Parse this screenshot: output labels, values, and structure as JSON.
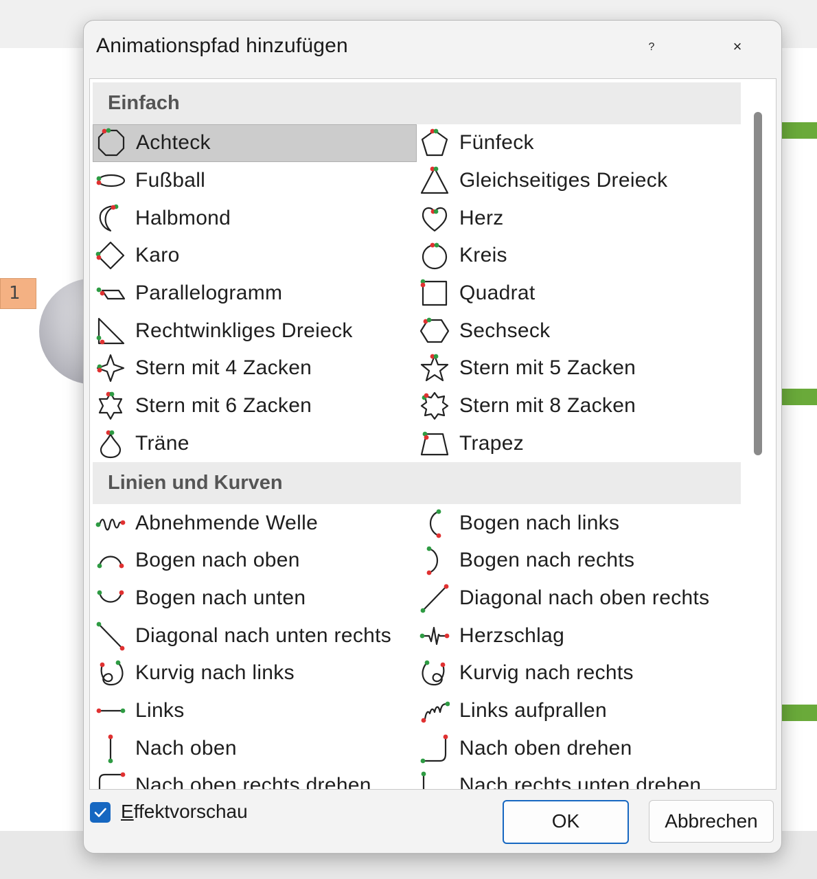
{
  "background": {
    "slide_number": "1"
  },
  "dialog": {
    "title": "Animationspfad hinzufügen",
    "help_glyph": "?",
    "close_glyph": "×"
  },
  "sections": [
    {
      "header": "Einfach",
      "items": [
        {
          "label": "Achteck",
          "icon": "octagon-path-icon",
          "selected": true
        },
        {
          "label": "Fünfeck",
          "icon": "pentagon-path-icon"
        },
        {
          "label": "Fußball",
          "icon": "football-path-icon"
        },
        {
          "label": "Gleichseitiges Dreieck",
          "icon": "equilateral-triangle-path-icon"
        },
        {
          "label": "Halbmond",
          "icon": "crescent-path-icon"
        },
        {
          "label": "Herz",
          "icon": "heart-path-icon"
        },
        {
          "label": "Karo",
          "icon": "diamond-path-icon"
        },
        {
          "label": "Kreis",
          "icon": "circle-path-icon"
        },
        {
          "label": "Parallelogramm",
          "icon": "parallelogram-path-icon"
        },
        {
          "label": "Quadrat",
          "icon": "square-path-icon"
        },
        {
          "label": "Rechtwinkliges Dreieck",
          "icon": "right-triangle-path-icon"
        },
        {
          "label": "Sechseck",
          "icon": "hexagon-path-icon"
        },
        {
          "label": "Stern mit 4 Zacken",
          "icon": "star-4-path-icon"
        },
        {
          "label": "Stern mit 5 Zacken",
          "icon": "star-5-path-icon"
        },
        {
          "label": "Stern mit 6 Zacken",
          "icon": "star-6-path-icon"
        },
        {
          "label": "Stern mit 8 Zacken",
          "icon": "star-8-path-icon"
        },
        {
          "label": "Träne",
          "icon": "teardrop-path-icon"
        },
        {
          "label": "Trapez",
          "icon": "trapezoid-path-icon"
        }
      ]
    },
    {
      "header": "Linien und Kurven",
      "items": [
        {
          "label": "Abnehmende Welle",
          "icon": "decaying-wave-path-icon"
        },
        {
          "label": "Bogen nach links",
          "icon": "arc-left-path-icon"
        },
        {
          "label": "Bogen nach oben",
          "icon": "arc-up-path-icon"
        },
        {
          "label": "Bogen nach rechts",
          "icon": "arc-right-path-icon"
        },
        {
          "label": "Bogen nach unten",
          "icon": "arc-down-path-icon"
        },
        {
          "label": "Diagonal nach oben rechts",
          "icon": "diagonal-up-right-path-icon"
        },
        {
          "label": "Diagonal nach unten rechts",
          "icon": "diagonal-down-right-path-icon"
        },
        {
          "label": "Herzschlag",
          "icon": "heartbeat-path-icon"
        },
        {
          "label": "Kurvig nach links",
          "icon": "curvy-left-path-icon"
        },
        {
          "label": "Kurvig nach rechts",
          "icon": "curvy-right-path-icon"
        },
        {
          "label": "Links",
          "icon": "left-line-path-icon"
        },
        {
          "label": "Links aufprallen",
          "icon": "bounce-left-path-icon"
        },
        {
          "label": "Nach oben",
          "icon": "up-line-path-icon"
        },
        {
          "label": "Nach oben drehen",
          "icon": "turn-up-path-icon"
        },
        {
          "label": "Nach oben rechts drehen",
          "icon": "turn-up-right-path-icon"
        },
        {
          "label": "Nach rechts unten drehen",
          "icon": "turn-down-right-path-icon"
        }
      ]
    }
  ],
  "footer": {
    "preview_label": "Effektvorschau",
    "preview_checked": true,
    "ok_label": "OK",
    "cancel_label": "Abbrechen"
  },
  "colors": {
    "accent": "#1667c1",
    "start_dot": "#2e9b43",
    "end_dot": "#e03131",
    "selection": "#cccccc"
  }
}
